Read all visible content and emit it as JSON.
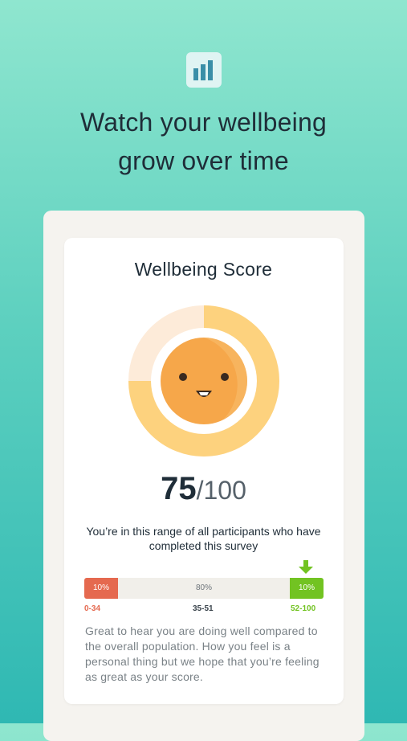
{
  "header": {
    "icon": "bar-chart-icon",
    "headline_line1": "Watch your wellbeing",
    "headline_line2": "grow over time"
  },
  "card": {
    "title": "Wellbeing Score",
    "face_icon": "smiley-face-icon",
    "score_value": "75",
    "score_max": "/100",
    "score_fraction": 0.75,
    "range_text": "You’re in this range of all participants who have completed this survey",
    "distribution": {
      "segments": [
        {
          "share": "10%",
          "range": "0-34",
          "color": "#e5694f"
        },
        {
          "share": "80%",
          "range": "35-51",
          "color": "#f1efea"
        },
        {
          "share": "10%",
          "range": "52-100",
          "color": "#72c322"
        }
      ],
      "current_segment_marker": "down-arrow-icon"
    },
    "message": "Great to hear you are doing well compared to the overall population. How you feel is a personal thing but we hope that you’re feeling as great as your score."
  },
  "colors": {
    "accent_teal": "#2fb8b3",
    "gauge_fill": "#fdd27e",
    "gauge_track": "#fdebd9",
    "face": "#f7a94a",
    "low": "#e5694f",
    "high": "#72c322"
  }
}
